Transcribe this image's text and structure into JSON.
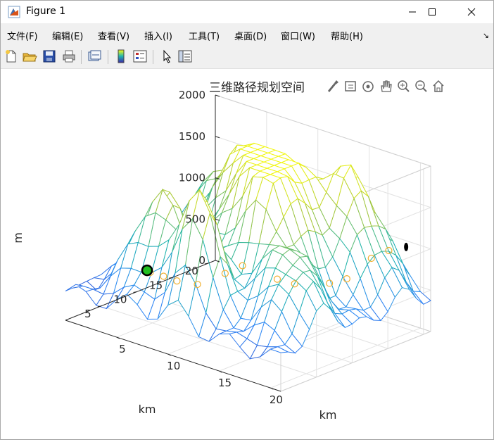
{
  "window": {
    "title": "Figure 1",
    "minimize_icon": "minimize-icon",
    "maximize_icon": "maximize-icon",
    "close_icon": "close-icon"
  },
  "menu": {
    "items": [
      "文件(F)",
      "编辑(E)",
      "查看(V)",
      "插入(I)",
      "工具(T)",
      "桌面(D)",
      "窗口(W)",
      "帮助(H)"
    ],
    "dock_arrow": "↘"
  },
  "toolbar": {
    "icons": [
      "new-figure-icon",
      "open-file-icon",
      "save-icon",
      "print-icon",
      "link-plot-icon",
      "insert-colorbar-icon",
      "insert-legend-icon",
      "edit-plot-arrow-icon",
      "property-inspector-icon"
    ]
  },
  "axes_toolbar": {
    "icons": [
      "brush-icon",
      "data-tips-icon",
      "rotate-3d-icon",
      "pan-icon",
      "zoom-in-icon",
      "zoom-out-icon",
      "home-icon"
    ]
  },
  "colors": {
    "surface_low": "#3e26a8",
    "surface_mid": "#1fb5b0",
    "surface_high": "#f9fb0e",
    "path_marker": "#f0b030",
    "start_marker": "#22c022",
    "end_marker": "#000000"
  },
  "chart_data": {
    "type": "surface",
    "title": "三维路径规划空间",
    "xlabel": "km",
    "ylabel": "km",
    "zlabel": "m",
    "xlim": [
      0,
      21
    ],
    "ylim": [
      0,
      21
    ],
    "zlim": [
      0,
      2000
    ],
    "x_ticks": [
      "5",
      "10",
      "15",
      "20"
    ],
    "y_ticks": [
      "5",
      "10",
      "15",
      "20"
    ],
    "z_ticks": [
      "0",
      "500",
      "1000",
      "1500",
      "2000"
    ],
    "grid": true,
    "colormap": "parula",
    "start_point": {
      "x": 1,
      "y": 10,
      "z": 300
    },
    "end_point": {
      "x": 20,
      "y": 19,
      "z": 1050
    }
  }
}
